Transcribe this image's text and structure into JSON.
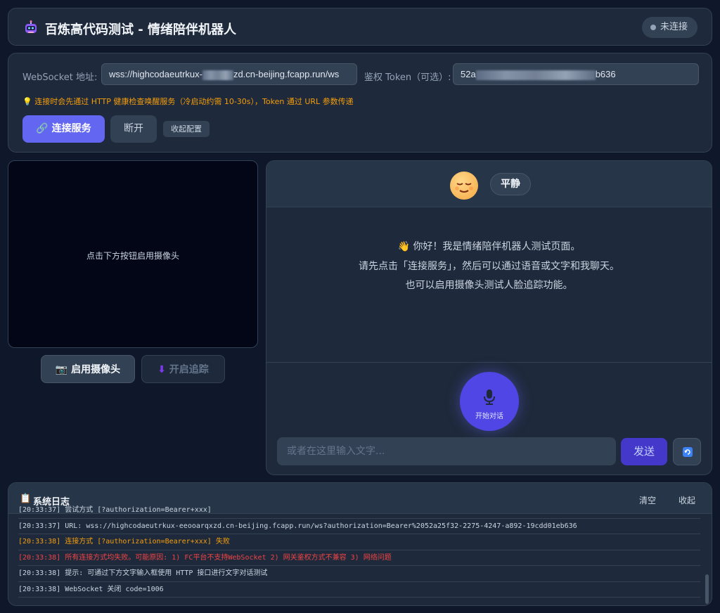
{
  "header": {
    "title": "百炼高代码测试 - 情绪陪伴机器人",
    "status": "未连接"
  },
  "config": {
    "ws_label": "WebSocket 地址:",
    "ws_value_start": "wss://highcodaeutrkux-",
    "ws_value_end": "zd.cn-beijing.fcapp.run/ws",
    "token_label": "鉴权 Token（可选）:",
    "token_value_start": "52a",
    "token_value_end": "b636",
    "hint": "连接时会先通过 HTTP 健康检查唤醒服务（冷启动约需 10-30s），Token 通过 URL 参数传递",
    "connect_label": "连接服务",
    "disconnect_label": "断开",
    "collapse_label": "收起配置"
  },
  "video": {
    "placeholder": "点击下方按钮启用摄像头",
    "camera_label": "启用摄像头",
    "track_label": "开启追踪"
  },
  "chat": {
    "mood": "平静",
    "welcome_line1": "你好！我是情绪陪伴机器人测试页面。",
    "welcome_line2": "请先点击「连接服务」，然后可以通过语音或文字和我聊天。",
    "welcome_line3": "也可以启用摄像头测试人脸追踪功能。",
    "mic_label": "开始对话",
    "input_placeholder": "或者在这里输入文字...",
    "send_label": "发送"
  },
  "log": {
    "title": "系统日志",
    "clear_label": "清空",
    "collapse_label": "收起",
    "lines": [
      {
        "text": "[20:33:37] 尝试方式 [?authorization=Bearer+xxx]",
        "color": "#cbd5e1"
      },
      {
        "text": "[20:33:37] URL: wss://highcodaeutrkux-eeooarqxzd.cn-beijing.fcapp.run/ws?authorization=Bearer%2052a25f32-2275-4247-a892-19cdd01eb636",
        "color": "#cbd5e1"
      },
      {
        "text": "[20:33:38] 连接方式 [?authorization=Bearer+xxx] 失败",
        "color": "#f59e0b"
      },
      {
        "text": "[20:33:38] 所有连接方式均失败。可能原因: 1) FC平台不支持WebSocket 2) 网关鉴权方式不兼容 3) 网络问题",
        "color": "#ef4444"
      },
      {
        "text": "[20:33:38] 提示: 可通过下方文字输入框使用 HTTP 接口进行文字对话测试",
        "color": "#cbd5e1"
      },
      {
        "text": "[20:33:38] WebSocket 关闭 code=1006",
        "color": "#cbd5e1"
      }
    ]
  }
}
